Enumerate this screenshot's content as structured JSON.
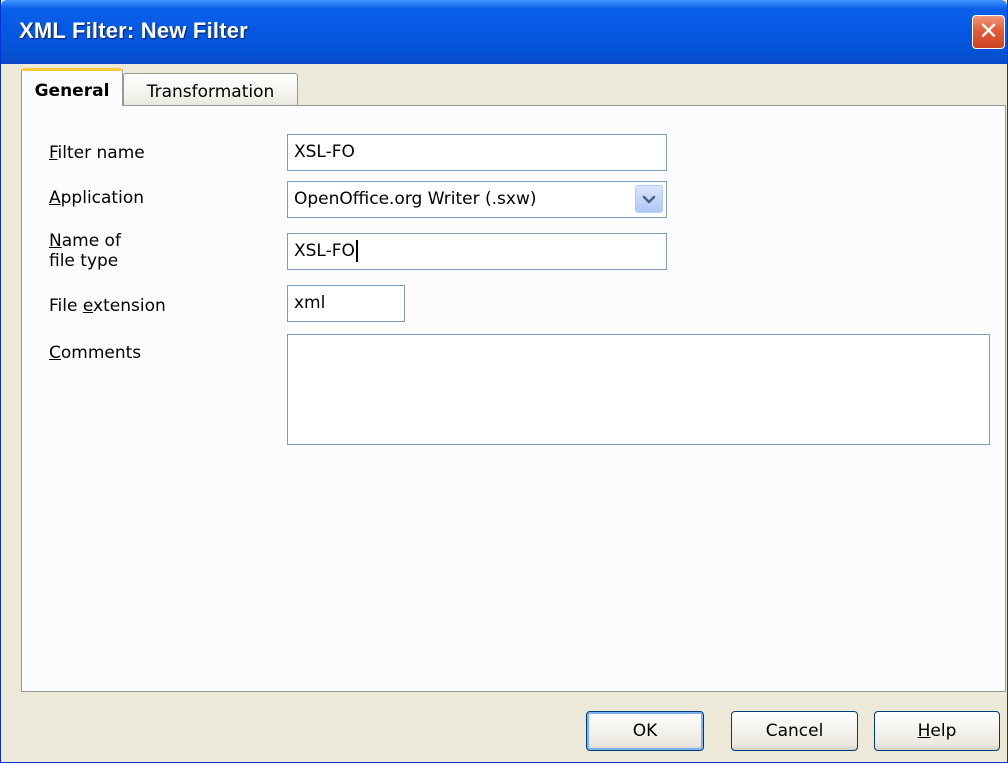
{
  "window": {
    "title": "XML Filter: New Filter",
    "close_glyph": "✕"
  },
  "tabs": [
    {
      "label": "General",
      "active": true
    },
    {
      "label": "Transformation",
      "active": false
    }
  ],
  "form": {
    "filter_name": {
      "label_mnemonic": "F",
      "label_rest": "ilter name",
      "value": "XSL-FO"
    },
    "application": {
      "label_mnemonic": "A",
      "label_rest": "pplication",
      "value": "OpenOffice.org Writer (.sxw)"
    },
    "file_type_name": {
      "label_mnemonic": "N",
      "label_rest_line1": "ame of",
      "label_line2": "file type",
      "value": "XSL-FO"
    },
    "file_extension": {
      "label_pre": "File ",
      "label_mnemonic": "e",
      "label_rest": "xtension",
      "value": "xml"
    },
    "comments": {
      "label_mnemonic": "C",
      "label_rest": "omments",
      "value": ""
    }
  },
  "buttons": {
    "ok": "OK",
    "cancel": "Cancel",
    "help_mnemonic": "H",
    "help_rest": "elp"
  },
  "colors": {
    "title_bar": "#0558e2",
    "active_tab_highlight": "#ffc83c",
    "close_button": "#e35d3a",
    "dialog_background": "#ece9d8"
  },
  "icons": {
    "close": "close-icon",
    "dropdown": "chevron-down-icon"
  }
}
